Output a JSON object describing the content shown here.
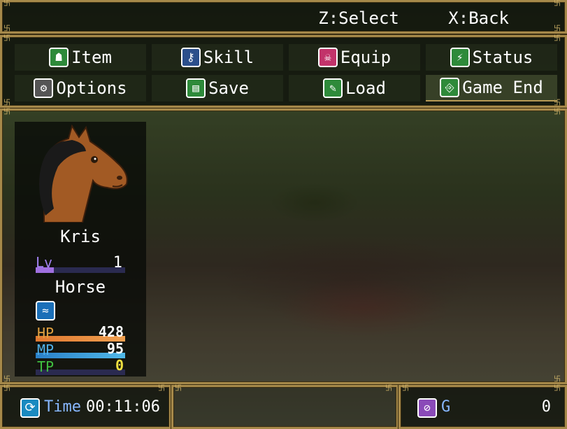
{
  "help": {
    "select": "Z:Select",
    "back": "X:Back"
  },
  "menu": {
    "items": [
      {
        "label": "Item",
        "icon": "item-bag-icon",
        "symbol": "☗",
        "color": "#2e8a3a"
      },
      {
        "label": "Skill",
        "icon": "skill-key-icon",
        "symbol": "⚷",
        "color": "#2b4f8c"
      },
      {
        "label": "Equip",
        "icon": "equip-skull-icon",
        "symbol": "☠",
        "color": "#c2336a"
      },
      {
        "label": "Status",
        "icon": "status-boot-icon",
        "symbol": "⚡",
        "color": "#2e8a3a"
      },
      {
        "label": "Options",
        "icon": "options-gear-icon",
        "symbol": "⚙",
        "color": "#555555"
      },
      {
        "label": "Save",
        "icon": "save-book-icon",
        "symbol": "▤",
        "color": "#2e8a3a"
      },
      {
        "label": "Load",
        "icon": "load-scroll-icon",
        "symbol": "✎",
        "color": "#2e8a3a"
      },
      {
        "label": "Game End",
        "icon": "game-end-door-icon",
        "symbol": "⎆",
        "color": "#2e8a3a"
      }
    ],
    "selected_index": 7
  },
  "actor": {
    "name": "Kris",
    "level_label": "Lv",
    "level": "1",
    "class": "Horse",
    "state_icon": "water-wave-icon",
    "hp_label": "HP",
    "hp": "428",
    "mp_label": "MP",
    "mp": "95",
    "tp_label": "TP",
    "tp": "0",
    "hp_rate": 1.0,
    "mp_rate": 1.0,
    "tp_rate": 0.0,
    "level_rate": 0.2
  },
  "footer": {
    "time_label": "Time",
    "time": "00:11:06",
    "gold_unit": "G",
    "gold": "0"
  },
  "colors": {
    "accent": "#a6894a",
    "hp": "#e08a3c",
    "mp": "#3aa0d8",
    "tp": "#3ec03e",
    "lv": "#a070e0"
  }
}
